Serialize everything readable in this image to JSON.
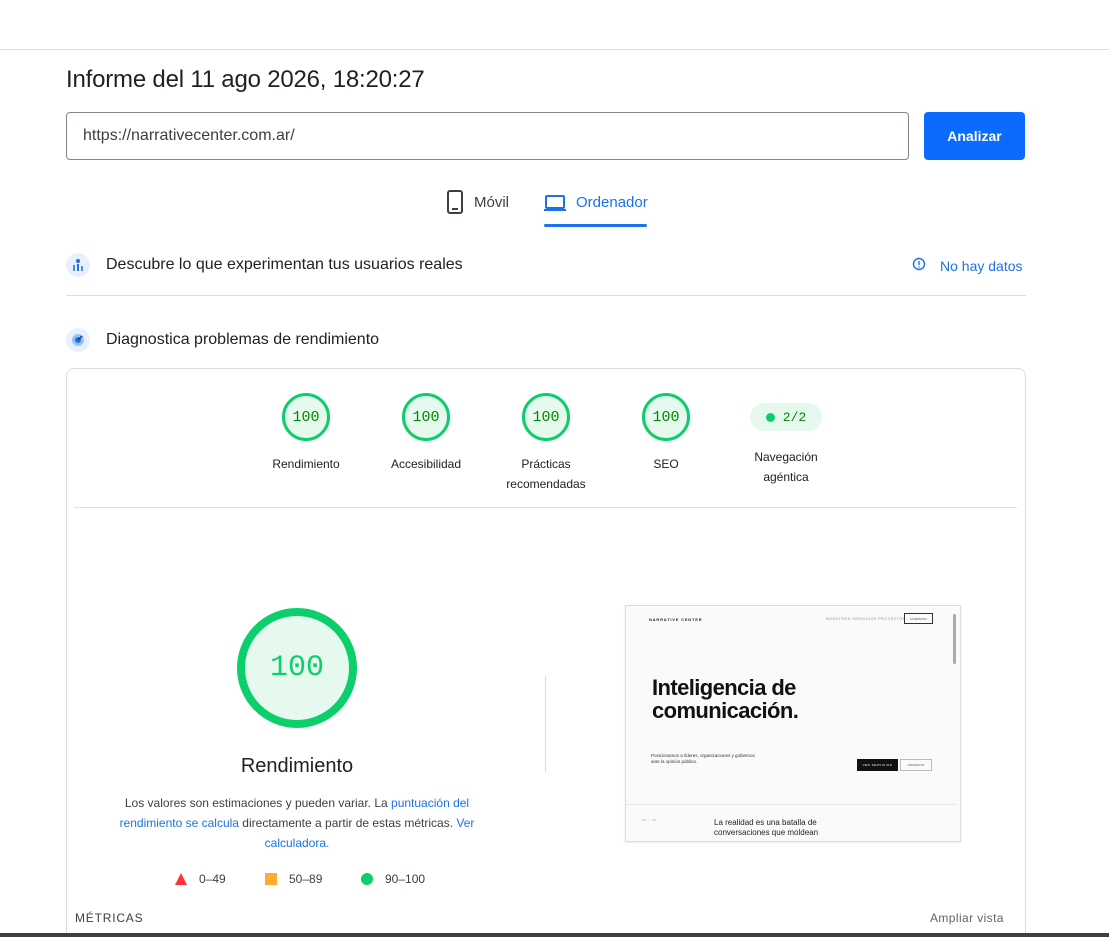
{
  "report": {
    "title": "Informe del 11 ago 2026, 18:20:27",
    "url_value": "https://narrativecenter.com.ar/",
    "analyze_label": "Analizar"
  },
  "tabs": [
    {
      "label": "Móvil",
      "icon": "smartphone-icon",
      "active": false
    },
    {
      "label": "Ordenador",
      "icon": "laptop-icon",
      "active": true
    }
  ],
  "field_data": {
    "label": "Descubre lo que experimentan tus usuarios reales",
    "status": "No hay datos",
    "icon": "users-chart-icon",
    "status_icon": "info-icon"
  },
  "lab_data": {
    "label": "Diagnostica problemas de rendimiento",
    "icon": "speedometer-icon"
  },
  "scores": [
    {
      "value": "100",
      "label": "Rendimiento"
    },
    {
      "value": "100",
      "label": "Accesibilidad"
    },
    {
      "value": "100",
      "label": "Prácticas recomendadas"
    },
    {
      "value": "100",
      "label": "SEO"
    }
  ],
  "agentic": {
    "value": "2/2",
    "label": "Navegación agéntica"
  },
  "performance": {
    "score": "100",
    "label": "Rendimiento",
    "desc_prefix": "Los valores son estimaciones y pueden variar. La ",
    "desc_link1": "puntuación del rendimiento se calcula",
    "desc_middle": " directamente a partir de estas métricas. ",
    "desc_link2": "Ver calculadora."
  },
  "legend": [
    {
      "range": "0–49",
      "shape": "triangle",
      "color": "#ff3333"
    },
    {
      "range": "50–89",
      "shape": "square",
      "color": "#ffaa33"
    },
    {
      "range": "90–100",
      "shape": "circle",
      "color": "#0cce6b"
    }
  ],
  "screenshot_preview": {
    "logo": "NARRATIVE CENTER",
    "links": "NOSOTROS   SERVICIOS   PROYECTOS",
    "cta": "CONTACTO",
    "headline": "Inteligencia de comunicación.",
    "subtext": "Posicionamos a líderes, organizaciones y gobiernos ante la opinión pública.",
    "btn_primary": "VER SERVICIOS",
    "btn_secondary": "CONTACTO",
    "section_tag": "01 / 04",
    "section_text": "La realidad es una batalla de conversaciones que moldean"
  },
  "metrics": {
    "heading": "MÉTRICAS",
    "expand_label": "Ampliar vista"
  },
  "colors": {
    "accent": "#1a73e8",
    "button": "#0b6bff",
    "pass": "#0cce6b"
  }
}
